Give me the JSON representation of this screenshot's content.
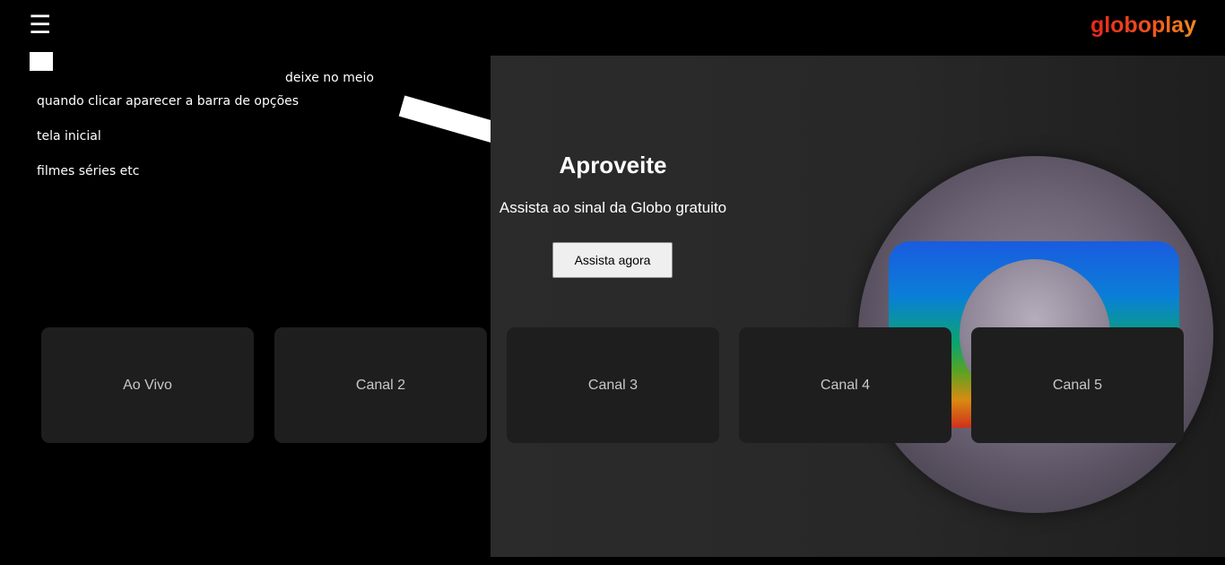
{
  "header": {
    "menu_icon": "hamburger-icon",
    "menu_glyph": "☰",
    "logo_text": "globoplay",
    "logo_colors": [
      "#e8271b",
      "#f58d1d"
    ]
  },
  "notes": {
    "middle": "deixe no meio",
    "bar": "quando clicar aparecer a barra de opções",
    "home": "tela inicial",
    "films": "filmes séries etc"
  },
  "hero": {
    "title": "Aproveite",
    "subtitle": "Assista ao sinal da Globo gratuito",
    "button_label": "Assista agora",
    "background_icon": "globo-globe-logo"
  },
  "channels": [
    {
      "label": "Ao Vivo"
    },
    {
      "label": "Canal 2"
    },
    {
      "label": "Canal 3"
    },
    {
      "label": "Canal 4"
    },
    {
      "label": "Canal 5"
    }
  ],
  "colors": {
    "background": "#000000",
    "hero_background": "#2b2b2b",
    "card_background": "#1e1e1e"
  }
}
